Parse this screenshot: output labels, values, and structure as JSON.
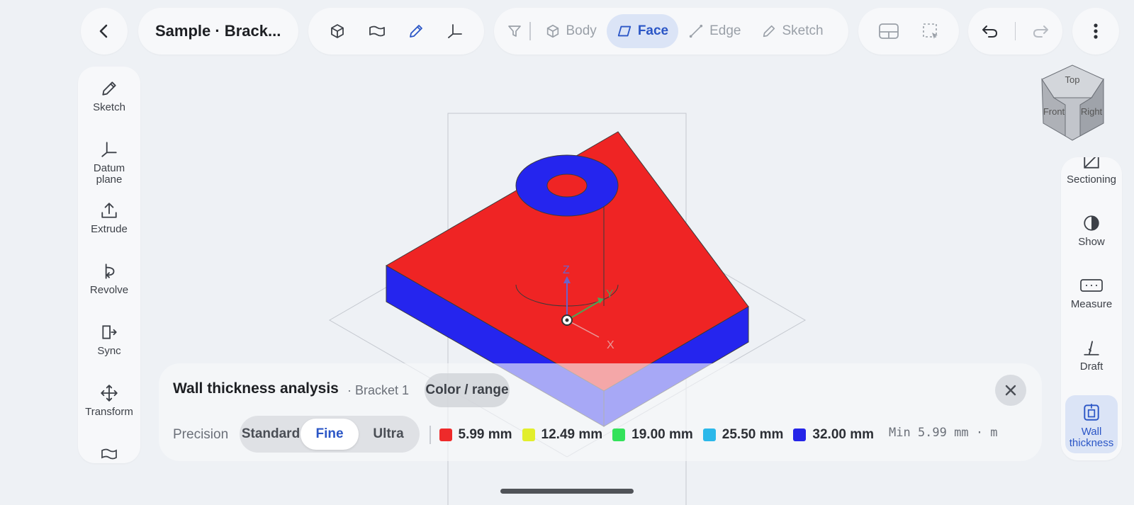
{
  "header": {
    "back_icon": "chevron-left-icon",
    "title": "Sample · Brack...",
    "tools": [
      "cube-icon",
      "surface-icon",
      "pencil-icon",
      "datum-icon"
    ],
    "filter": {
      "icon": "filter-icon",
      "items": [
        {
          "label": "Body",
          "icon": "cube-icon",
          "active": false
        },
        {
          "label": "Face",
          "icon": "face-icon",
          "active": true
        },
        {
          "label": "Edge",
          "icon": "edge-icon",
          "active": false
        },
        {
          "label": "Sketch",
          "icon": "pencil-icon",
          "active": false
        }
      ]
    },
    "view_tools": [
      "layout-icon",
      "selection-box-icon"
    ],
    "undo_icon": "undo-icon",
    "redo_icon": "redo-icon",
    "more_icon": "more-vertical-icon"
  },
  "left_toolbar": [
    {
      "label": "Sketch",
      "icon": "pencil-icon"
    },
    {
      "label": "Datum plane",
      "icon": "datum-icon"
    },
    {
      "label": "Extrude",
      "icon": "extrude-icon"
    },
    {
      "label": "Revolve",
      "icon": "revolve-icon"
    },
    {
      "label": "Sync",
      "icon": "sync-icon"
    },
    {
      "label": "Transform",
      "icon": "move-icon"
    }
  ],
  "right_toolbar": [
    {
      "label": "Sectioning",
      "icon": "section-icon"
    },
    {
      "label": "Show",
      "icon": "half-circle-icon"
    },
    {
      "label": "Measure",
      "icon": "ruler-icon"
    },
    {
      "label": "Draft",
      "icon": "draft-icon"
    },
    {
      "label": "Wall thickness",
      "icon": "wall-thickness-icon",
      "active": true
    }
  ],
  "viewcube": {
    "top": "Top",
    "front": "Front",
    "right": "Right"
  },
  "axes": {
    "z": "Z",
    "y": "Y",
    "x": "X"
  },
  "analysis": {
    "title": "Wall thickness analysis",
    "subtitle": "· Bracket 1",
    "color_range_label": "Color / range",
    "close_icon": "close-icon",
    "precision_label": "Precision",
    "precision_options": [
      "Standard",
      "Fine",
      "Ultra"
    ],
    "precision_selected": "Fine",
    "legend": [
      {
        "label": "5.99 mm",
        "color": "#ee2a2a"
      },
      {
        "label": "12.49 mm",
        "color": "#e2ee2c"
      },
      {
        "label": "19.00 mm",
        "color": "#33e25a"
      },
      {
        "label": "25.50 mm",
        "color": "#2bb8ea"
      },
      {
        "label": "32.00 mm",
        "color": "#2424e8"
      }
    ],
    "minmax": "Min 5.99 mm · m"
  },
  "colors": {
    "accent": "#2b56c6",
    "thin": "#ef2424",
    "thick": "#2525ee"
  }
}
